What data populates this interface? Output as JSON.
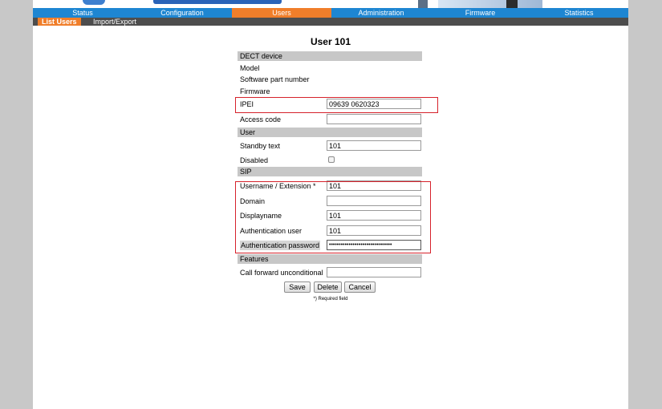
{
  "nav": {
    "tabs": [
      {
        "label": "Status"
      },
      {
        "label": "Configuration"
      },
      {
        "label": "Users"
      },
      {
        "label": "Administration"
      },
      {
        "label": "Firmware"
      },
      {
        "label": "Statistics"
      }
    ],
    "subtabs": [
      {
        "label": "List Users"
      },
      {
        "label": "Import/Export"
      }
    ]
  },
  "page": {
    "title": "User 101"
  },
  "sections": {
    "dect": "DECT device",
    "user": "User",
    "sip": "SIP",
    "features": "Features"
  },
  "fields": {
    "model": {
      "label": "Model"
    },
    "software_part_number": {
      "label": "Software part number"
    },
    "firmware": {
      "label": "Firmware"
    },
    "ipei": {
      "label": "IPEI",
      "value": "09639 0620323"
    },
    "access_code": {
      "label": "Access code",
      "value": ""
    },
    "standby_text": {
      "label": "Standby text",
      "value": "101"
    },
    "disabled": {
      "label": "Disabled"
    },
    "username": {
      "label": "Username / Extension *",
      "value": "101"
    },
    "domain": {
      "label": "Domain",
      "value": ""
    },
    "displayname": {
      "label": "Displayname",
      "value": "101"
    },
    "auth_user": {
      "label": "Authentication user",
      "value": "101"
    },
    "auth_password": {
      "label": "Authentication password",
      "value": "••••••••••••••••••••••••••••••••"
    },
    "call_forward": {
      "label": "Call forward unconditional",
      "value": ""
    }
  },
  "buttons": {
    "save": "Save",
    "delete": "Delete",
    "cancel": "Cancel"
  },
  "footer": {
    "required_note": "*) Required field"
  },
  "colors": {
    "accent": "#f07e2a",
    "nav_blue": "#1e86d2",
    "highlight": "#d6222b",
    "section_gray": "#c7c7c7"
  }
}
